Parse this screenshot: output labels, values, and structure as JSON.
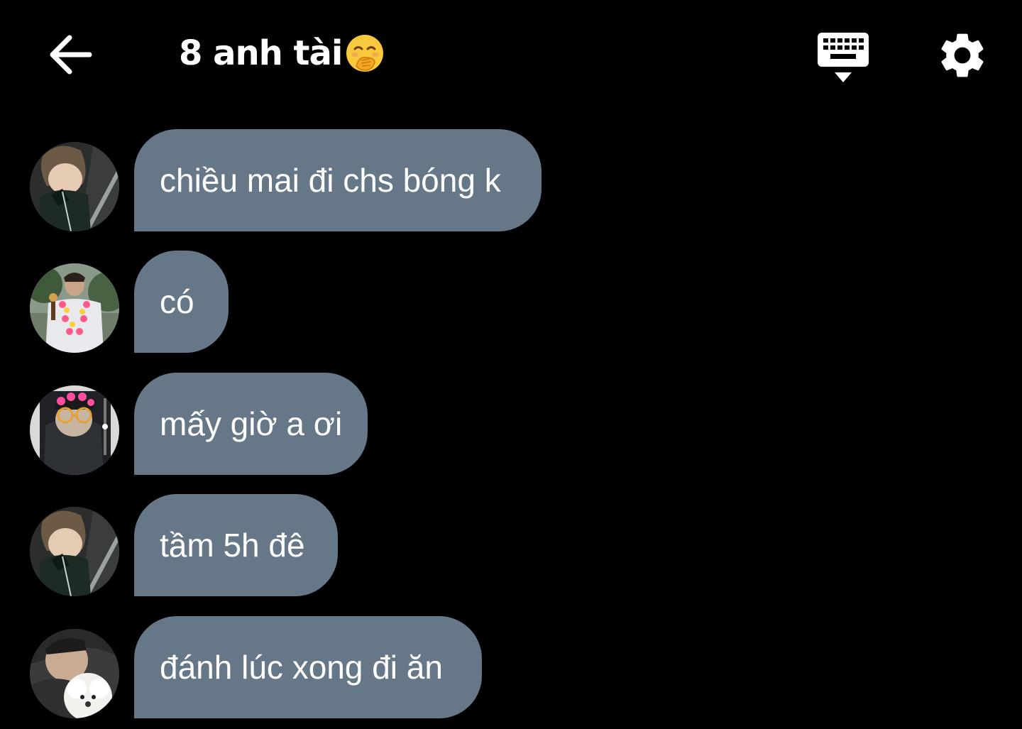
{
  "header": {
    "title": "8 anh tài",
    "back_icon": "arrow-left-icon",
    "keyboard_icon": "keyboard-hide-icon",
    "settings_icon": "gear-icon"
  },
  "colors": {
    "background": "#000000",
    "bubble": "#667788",
    "text": "#ffffff"
  },
  "messages": [
    {
      "text": "chiều mai đi chs bóng k"
    },
    {
      "text": "có"
    },
    {
      "text": "mấy giờ a ơi"
    },
    {
      "text": "tầm 5h đê"
    },
    {
      "text": "đánh lúc xong đi ăn"
    }
  ]
}
